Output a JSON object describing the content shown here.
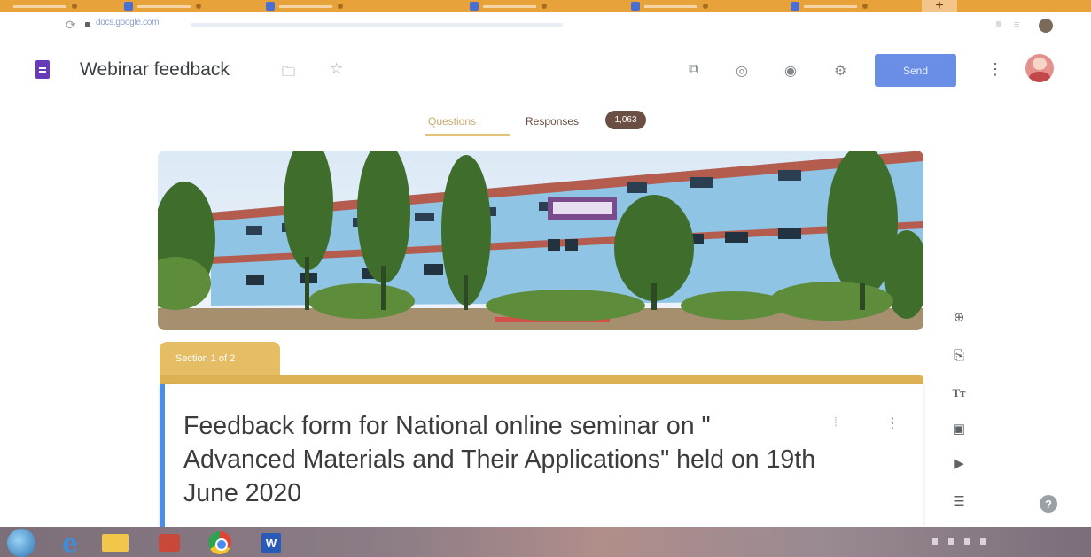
{
  "browser": {
    "address_host": "docs.google.com"
  },
  "header": {
    "doc_title": "Webinar feedback",
    "send_label": "Send",
    "icons": [
      "folder-icon",
      "star-icon",
      "addon-icon",
      "palette-icon",
      "preview-icon",
      "settings-icon",
      "more-vert-icon",
      "avatar"
    ]
  },
  "tabs": {
    "questions_label": "Questions",
    "responses_label": "Responses",
    "responses_count": "1,063"
  },
  "section": {
    "label": "Section 1 of 2"
  },
  "form": {
    "title": "Feedback form for National online seminar on \" Advanced Materials and Their Applications\"   held on 19th June 2020"
  },
  "toolbar": {
    "items": [
      "add-question-icon",
      "import-questions-icon",
      "add-title-icon",
      "add-image-icon",
      "add-video-icon",
      "add-section-icon"
    ],
    "title_glyph": "Tт"
  },
  "colors": {
    "theme_accent": "#dcb153",
    "send_button": "#6a8ee6",
    "card_focus_border": "#4f8de0",
    "responses_badge": "#6b4e44"
  },
  "taskbar": {
    "pinned": [
      "start-button",
      "internet-explorer-icon",
      "file-explorer-icon",
      "media-player-icon",
      "chrome-icon",
      "word-icon"
    ],
    "word_glyph": "W"
  }
}
